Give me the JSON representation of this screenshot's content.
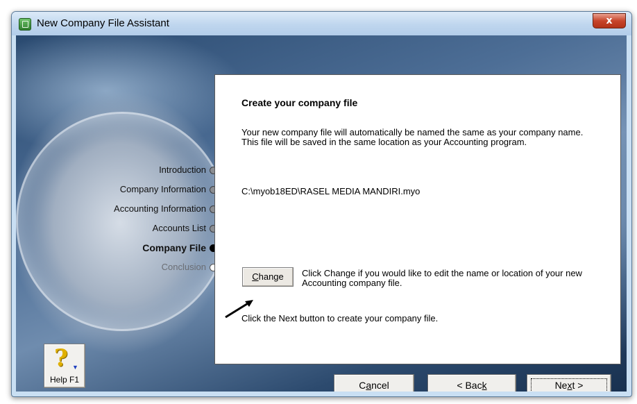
{
  "window": {
    "title": "New Company File Assistant",
    "close_glyph": "x"
  },
  "steps": [
    {
      "label": "Introduction",
      "state": "done"
    },
    {
      "label": "Company Information",
      "state": "done"
    },
    {
      "label": "Accounting Information",
      "state": "done"
    },
    {
      "label": "Accounts List",
      "state": "done"
    },
    {
      "label": "Company File",
      "state": "current"
    },
    {
      "label": "Conclusion",
      "state": "future"
    }
  ],
  "panel": {
    "heading": "Create your company file",
    "description": "Your new company file will automatically be named the same as your company name.  This file will be saved in the same location as your Accounting program.",
    "file_path": "C:\\myob18ED\\RASEL MEDIA MANDIRI.myo",
    "change_button": {
      "pre": "",
      "accel": "C",
      "post": "hange"
    },
    "change_hint": "Click Change if you would like to edit the name or location of your new Accounting company file.",
    "next_hint": "Click the Next button to create your company file."
  },
  "help": {
    "label": "Help F1",
    "icon": "question-mark-icon"
  },
  "buttons": {
    "cancel": {
      "pre": "C",
      "accel": "a",
      "post": "ncel"
    },
    "back": {
      "pre": "< Bac",
      "accel": "k",
      "post": ""
    },
    "next": {
      "pre": "Ne",
      "accel": "x",
      "post": "t >"
    }
  },
  "colors": {
    "help_icon": "#e0b000",
    "close_button": "#c7452b"
  }
}
